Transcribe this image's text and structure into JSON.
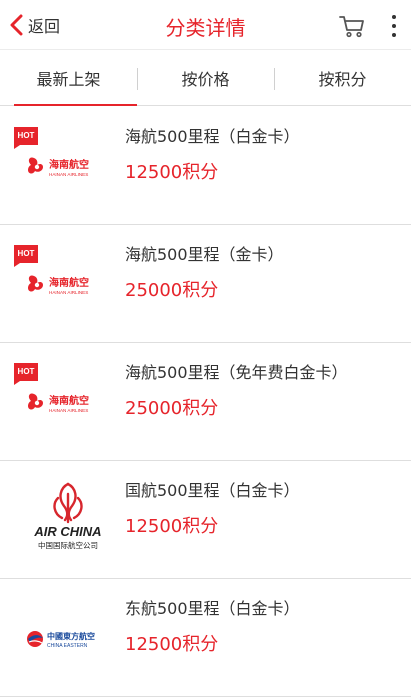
{
  "header": {
    "back_label": "返回",
    "title": "分类详情"
  },
  "tabs": [
    {
      "label": "最新上架",
      "active": true
    },
    {
      "label": "按价格",
      "active": false
    },
    {
      "label": "按积分",
      "active": false
    }
  ],
  "products": [
    {
      "title": "海航500里程（白金卡）",
      "points": "12500积分",
      "badge": "HOT",
      "logo": "hainan-airlines-logo"
    },
    {
      "title": "海航500里程（金卡）",
      "points": "25000积分",
      "badge": "HOT",
      "logo": "hainan-airlines-logo"
    },
    {
      "title": "海航500里程（免年费白金卡）",
      "points": "25000积分",
      "badge": "HOT",
      "logo": "hainan-airlines-logo"
    },
    {
      "title": "国航500里程（白金卡）",
      "points": "12500积分",
      "badge": "",
      "logo": "air-china-logo"
    },
    {
      "title": "东航500里程（白金卡）",
      "points": "12500积分",
      "badge": "",
      "logo": "china-eastern-logo"
    }
  ],
  "logos": {
    "hainan": {
      "cn": "海南航空",
      "en": "HAINAN AIRLINES"
    },
    "airchina": {
      "en": "AIR CHINA",
      "cn": "中国国际航空公司"
    },
    "eastern": {
      "cn": "中國東方航空",
      "en": "CHINA EASTERN"
    }
  },
  "colors": {
    "accent": "#e6242b",
    "text": "#333333",
    "divider": "#dedede",
    "eastern_blue": "#1a4a9c"
  },
  "icons": [
    "chevron-left-icon",
    "cart-icon",
    "more-vertical-icon"
  ]
}
